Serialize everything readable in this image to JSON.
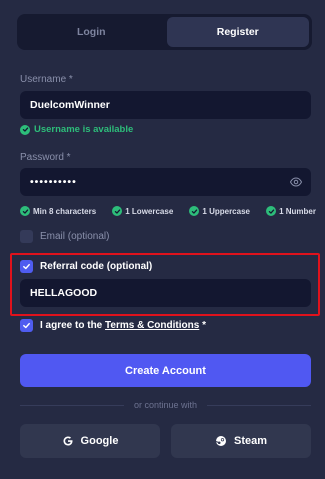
{
  "tabs": [
    {
      "label": "Login",
      "active": false
    },
    {
      "label": "Register",
      "active": true
    }
  ],
  "username": {
    "label": "Username *",
    "value": "DuelcomWinner",
    "status": "Username is available"
  },
  "password": {
    "label": "Password *",
    "value": "••••••••••",
    "requirements": [
      "Min 8 characters",
      "1 Lowercase",
      "1 Uppercase",
      "1 Number"
    ]
  },
  "email_option": {
    "label": "Email (optional)",
    "checked": false
  },
  "referral": {
    "label": "Referral code (optional)",
    "checked": true,
    "value": "HELLAGOOD"
  },
  "agree": {
    "prefix": "I agree to the",
    "link": "Terms & Conditions",
    "suffix": "*",
    "checked": true
  },
  "create_account": "Create Account",
  "divider": "or continue with",
  "social": [
    {
      "label": "Google",
      "icon": "google-icon"
    },
    {
      "label": "Steam",
      "icon": "steam-icon"
    }
  ],
  "colors": {
    "accent": "#5058f2",
    "success": "#2dbd7a",
    "highlight": "#e0121c",
    "background": "#252a43"
  }
}
